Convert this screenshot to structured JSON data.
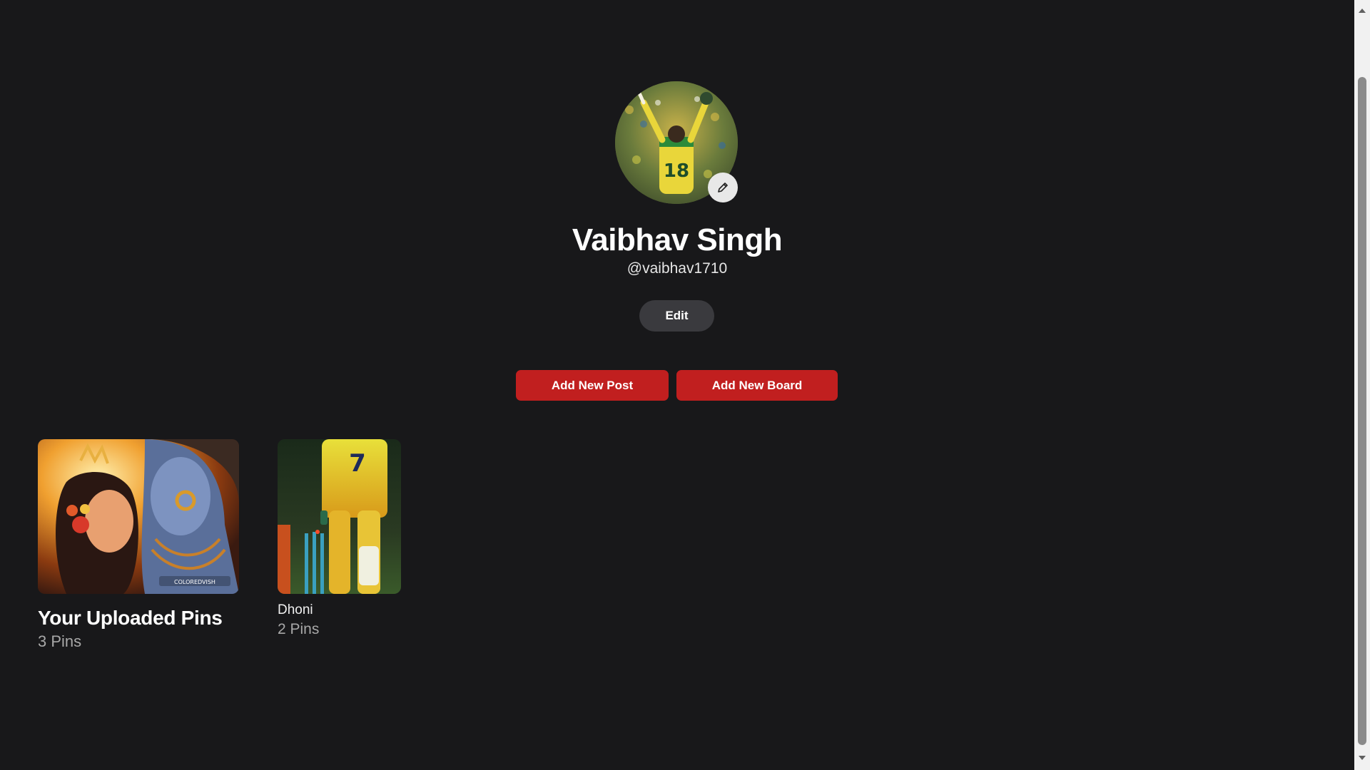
{
  "profile": {
    "name": "Vaibhav Singh",
    "handle": "@vaibhav1710",
    "edit_label": "Edit",
    "avatar_icon": "pencil-icon"
  },
  "actions": {
    "add_post_label": "Add New Post",
    "add_board_label": "Add New Board"
  },
  "boards": [
    {
      "title": "Your Uploaded Pins",
      "count": "3 Pins"
    },
    {
      "title": "Dhoni",
      "count": "2 Pins"
    }
  ],
  "colors": {
    "background": "#18181a",
    "accent_red": "#c11f1f",
    "edit_button": "#3a3a3e"
  }
}
